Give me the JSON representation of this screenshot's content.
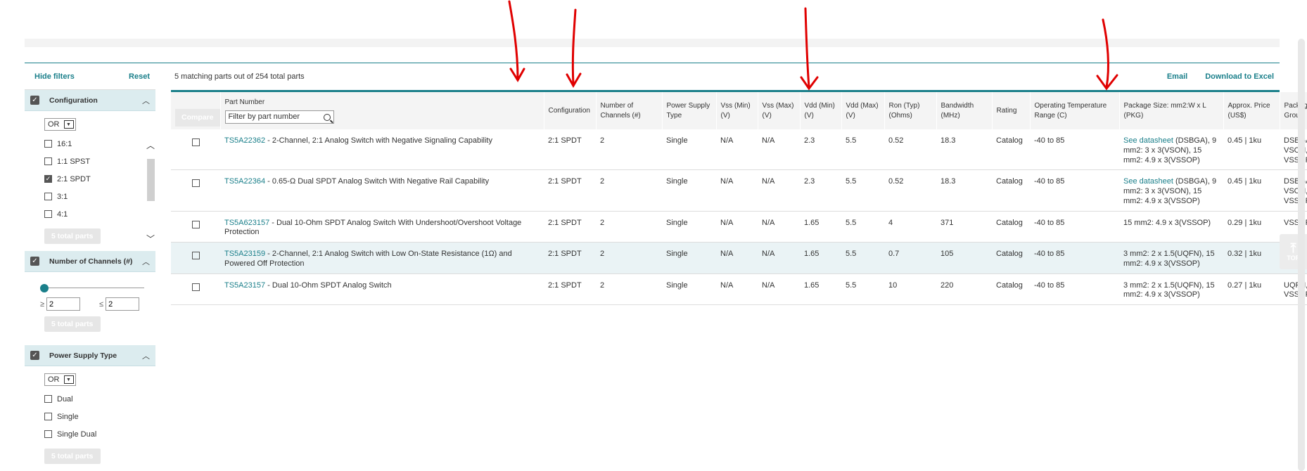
{
  "sidebar": {
    "hide_filters": "Hide filters",
    "reset": "Reset",
    "facets": {
      "configuration": {
        "title": "Configuration",
        "operator": "OR",
        "options": [
          {
            "label": "16:1",
            "checked": false
          },
          {
            "label": "1:1 SPST",
            "checked": false
          },
          {
            "label": "2:1 SPDT",
            "checked": true
          },
          {
            "label": "3:1",
            "checked": false
          },
          {
            "label": "4:1",
            "checked": false
          }
        ],
        "apply": "5 total parts"
      },
      "channels": {
        "title": "Number of Channels (#)",
        "min_label": "≥",
        "max_label": "≤",
        "min": "2",
        "max": "2",
        "apply": "5 total parts"
      },
      "power": {
        "title": "Power Supply Type",
        "operator": "OR",
        "options": [
          {
            "label": "Dual",
            "checked": false
          },
          {
            "label": "Single",
            "checked": false
          },
          {
            "label": "Single Dual",
            "checked": false
          }
        ],
        "apply": "5 total parts"
      }
    }
  },
  "results": {
    "count": "5 matching parts out of 254 total parts",
    "email": "Email",
    "download": "Download to Excel"
  },
  "table": {
    "compare": "Compare",
    "part_number_header": "Part Number",
    "filter_placeholder": "Filter by part number",
    "headers": {
      "config": "Configuration",
      "channels": "Number of Channels (#)",
      "supply": "Power Supply Type",
      "vss_min": "Vss (Min) (V)",
      "vss_max": "Vss (Max) (V)",
      "vdd_min": "Vdd (Min) (V)",
      "vdd_max": "Vdd (Max) (V)",
      "ron": "Ron (Typ) (Ohms)",
      "bw": "Bandwidth (MHz)",
      "rating": "Rating",
      "temp": "Operating Temperature Range (C)",
      "pkg_size": "Package Size: mm2:W x L (PKG)",
      "price": "Approx. Price (US$)",
      "pkg_group": "Package Group"
    },
    "rows": [
      {
        "pn": "TS5A22362",
        "desc": " - 2-Channel, 2:1 Analog Switch with Negative Signaling Capability",
        "config": "2:1 SPDT",
        "channels": "2",
        "supply": "Single",
        "vss_min": "N/A",
        "vss_max": "N/A",
        "vdd_min": "2.3",
        "vdd_max": "5.5",
        "ron": "0.52",
        "bw": "18.3",
        "rating": "Catalog",
        "temp": "-40 to 85",
        "pkg_link": "See datasheet",
        "pkg_size": " (DSBGA), 9 mm2: 3 x 3(VSON), 15 mm2: 4.9 x 3(VSSOP)",
        "price": "0.45 | 1ku",
        "pkg_group": "DSBGA, VSON, VSSOP"
      },
      {
        "pn": "TS5A22364",
        "desc": " - 0.65-Ω Dual SPDT Analog Switch With Negative Rail Capability",
        "config": "2:1 SPDT",
        "channels": "2",
        "supply": "Single",
        "vss_min": "N/A",
        "vss_max": "N/A",
        "vdd_min": "2.3",
        "vdd_max": "5.5",
        "ron": "0.52",
        "bw": "18.3",
        "rating": "Catalog",
        "temp": "-40 to 85",
        "pkg_link": "See datasheet",
        "pkg_size": " (DSBGA), 9 mm2: 3 x 3(VSON), 15 mm2: 4.9 x 3(VSSOP)",
        "price": "0.45 | 1ku",
        "pkg_group": "DSBGA, VSON, VSSOP"
      },
      {
        "pn": "TS5A623157",
        "desc": " - Dual 10-Ohm SPDT Analog Switch With Undershoot/Overshoot Voltage Protection",
        "config": "2:1 SPDT",
        "channels": "2",
        "supply": "Single",
        "vss_min": "N/A",
        "vss_max": "N/A",
        "vdd_min": "1.65",
        "vdd_max": "5.5",
        "ron": "4",
        "bw": "371",
        "rating": "Catalog",
        "temp": "-40 to 85",
        "pkg_link": "",
        "pkg_size": "15 mm2: 4.9 x 3(VSSOP)",
        "price": "0.29 | 1ku",
        "pkg_group": "VSSOP"
      },
      {
        "pn": "TS5A23159",
        "desc": " - 2-Channel, 2:1 Analog Switch with Low On-State Resistance (1Ω) and Powered Off Protection",
        "config": "2:1 SPDT",
        "channels": "2",
        "supply": "Single",
        "vss_min": "N/A",
        "vss_max": "N/A",
        "vdd_min": "1.65",
        "vdd_max": "5.5",
        "ron": "0.7",
        "bw": "105",
        "rating": "Catalog",
        "temp": "-40 to 85",
        "pkg_link": "",
        "pkg_size": "3 mm2: 2 x 1.5(UQFN), 15 mm2: 4.9 x 3(VSSOP)",
        "price": "0.32 | 1ku",
        "pkg_group": "UQFN, VSSOP"
      },
      {
        "pn": "TS5A23157",
        "desc": " - Dual 10-Ohm SPDT Analog Switch",
        "config": "2:1 SPDT",
        "channels": "2",
        "supply": "Single",
        "vss_min": "N/A",
        "vss_max": "N/A",
        "vdd_min": "1.65",
        "vdd_max": "5.5",
        "ron": "10",
        "bw": "220",
        "rating": "Catalog",
        "temp": "-40 to 85",
        "pkg_link": "",
        "pkg_size": "3 mm2: 2 x 1.5(UQFN), 15 mm2: 4.9 x 3(VSSOP)",
        "price": "0.27 | 1ku",
        "pkg_group": "UQFN, VSSOP"
      }
    ]
  },
  "top_button": "TOP",
  "annotation_color": "#e00000"
}
